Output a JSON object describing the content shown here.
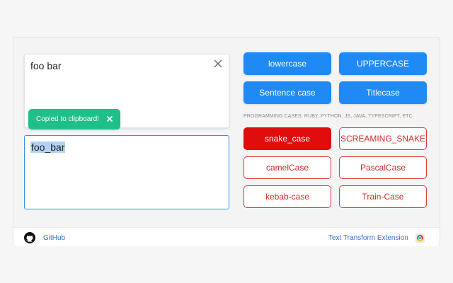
{
  "input": {
    "text": "foo bar"
  },
  "toast": {
    "message": "Copied to clipboard!"
  },
  "output": {
    "text": "foo_bar"
  },
  "buttons": {
    "lowercase": "lowercase",
    "uppercase": "UPPERCASE",
    "sentence": "Sentence case",
    "titlecase": "Titlecase",
    "snake": "snake_case",
    "screaming": "SCREAMING_SNAKE",
    "camel": "camelCase",
    "pascal": "PascalCase",
    "kebab": "kebab-case",
    "train": "Train-Case"
  },
  "programming_label": "PROGRAMMING CASES: RUBY, PYTHON, JS, JAVA, TYPESCRIPT, ETC",
  "footer": {
    "github": "GitHub",
    "extension": "Text Transform Extension"
  },
  "colors": {
    "accent_blue": "#1f8af5",
    "active_red": "#e10d0d",
    "toast_green": "#1fbf8a"
  },
  "icons": [
    "close-icon",
    "toast-close-icon",
    "github-icon",
    "chrome-icon"
  ]
}
